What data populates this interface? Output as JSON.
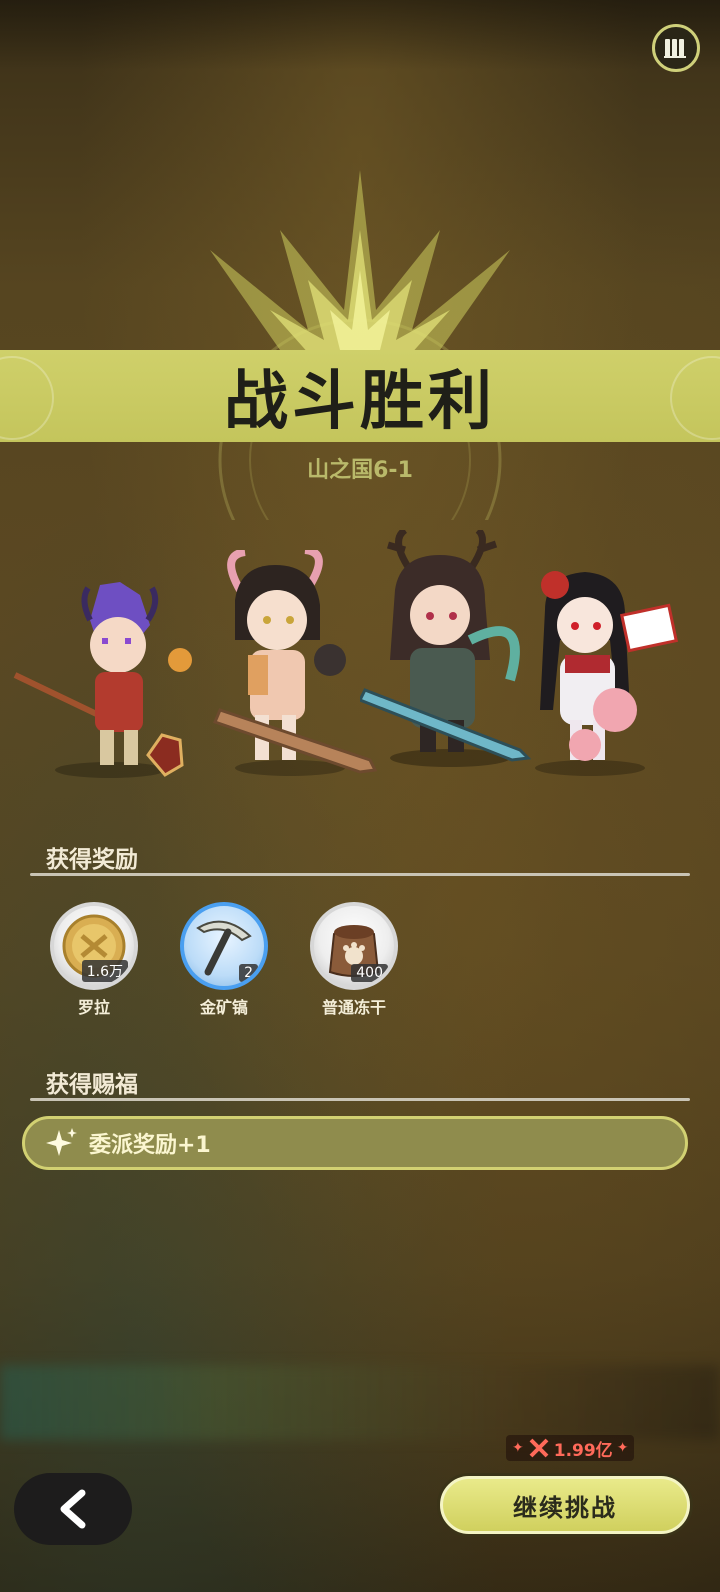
{
  "header": {
    "menu_icon": "book-stack-icon"
  },
  "result": {
    "title": "战斗胜利",
    "stage": "山之国6-1"
  },
  "party": {
    "heroes": [
      "purple-haired-lantern-hero",
      "pink-horned-sword-hero",
      "antlered-greatsword-hero",
      "rose-maiden-hero"
    ]
  },
  "rewards": {
    "section_title": "获得奖励",
    "items": [
      {
        "name": "罗拉",
        "count": "1.6万",
        "icon": "gold-coin-icon"
      },
      {
        "name": "金矿镐",
        "count": "2",
        "icon": "pickaxe-icon"
      },
      {
        "name": "普通冻干",
        "count": "400",
        "icon": "food-sack-icon"
      }
    ]
  },
  "blessings": {
    "section_title": "获得赐福",
    "items": [
      {
        "text": "委派奖励+1",
        "icon": "sparkle-icon"
      }
    ]
  },
  "footer": {
    "back_icon": "chevron-left-icon",
    "power_value": "1.99亿",
    "power_icon": "crossed-swords-icon",
    "continue_label": "继续挑战"
  },
  "colors": {
    "accent": "#cfd06a",
    "power_red": "#ff6a5a",
    "text_light": "#f2ead5"
  }
}
